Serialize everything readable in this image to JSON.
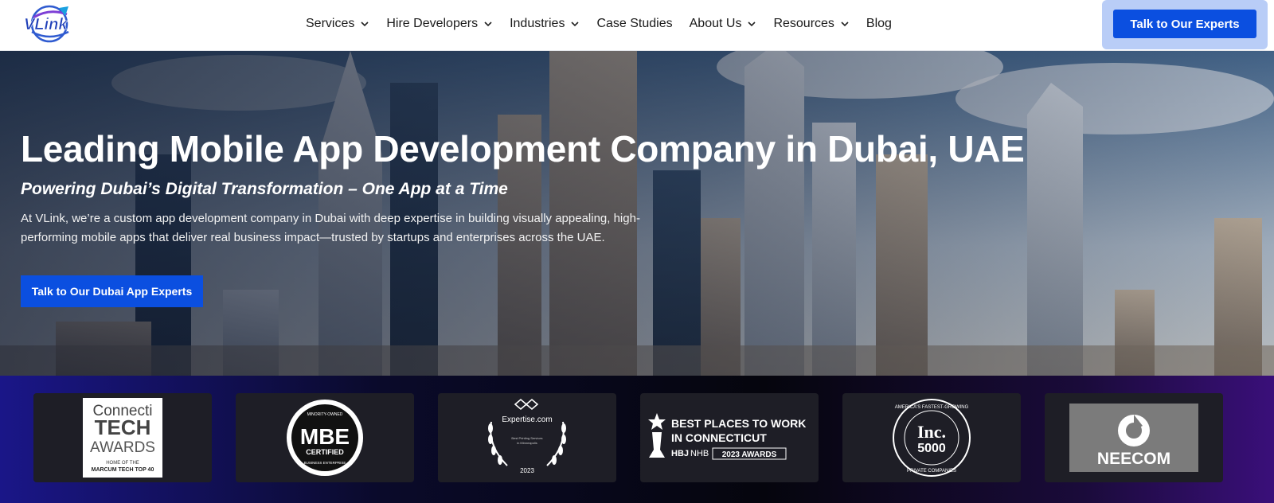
{
  "nav": {
    "logo_text": "VLink",
    "items": [
      {
        "label": "Services",
        "has_dropdown": true
      },
      {
        "label": "Hire Developers",
        "has_dropdown": true
      },
      {
        "label": "Industries",
        "has_dropdown": true
      },
      {
        "label": "Case Studies",
        "has_dropdown": false
      },
      {
        "label": "About Us",
        "has_dropdown": true
      },
      {
        "label": "Resources",
        "has_dropdown": true
      },
      {
        "label": "Blog",
        "has_dropdown": false
      }
    ],
    "cta_label": "Talk to Our Experts"
  },
  "hero": {
    "title": "Leading Mobile App Development Company in Dubai, UAE",
    "subtitle": "Powering Dubai’s Digital Transformation – One App at a Time",
    "description": "At VLink, we’re a custom app development company in Dubai with deep expertise in building visually appealing, high-performing mobile apps that deliver real business impact—trusted by startups and enterprises across the UAE.",
    "cta_label": "Talk to Our Dubai App Experts"
  },
  "awards": {
    "connectitech": {
      "line1": "Connecti",
      "line2": "TECH",
      "line3": "AWARDS",
      "line4": "HOME OF THE",
      "line5": "MARCUM TECH TOP 40"
    },
    "mbe": {
      "top": "MINORITY-OWNED",
      "main": "MBE",
      "sub": "CERTIFIED",
      "bottom": "BUSINESS ENTERPRISE"
    },
    "expertise": {
      "name": "Expertise.com",
      "desc1": "Best Printing Services",
      "desc2": "in Minneapolis",
      "year": "2023"
    },
    "best_places": {
      "line1": "BEST PLACES TO WORK",
      "line2": "IN CONNECTICUT",
      "hbj": "HBJ",
      "nhb": "NHB",
      "awards": "2023 AWARDS"
    },
    "inc": {
      "top": "AMERICA'S FASTEST-GROWING",
      "main": "Inc.",
      "num": "5000",
      "bottom": "PRIVATE COMPANIES"
    },
    "neecom": {
      "name": "NEECOM"
    }
  },
  "colors": {
    "brand_blue": "#0b4fe0",
    "cta_highlight": "#b9cdf7"
  }
}
